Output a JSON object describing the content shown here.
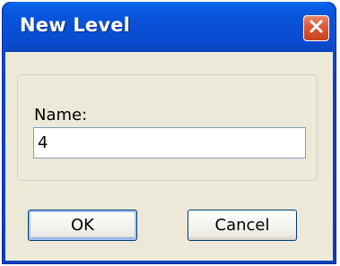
{
  "dialog": {
    "title": "New Level",
    "name_label": "Name:",
    "name_value": "4",
    "ok_label": "OK",
    "cancel_label": "Cancel"
  },
  "icons": {
    "close": "close-icon"
  },
  "colors": {
    "titlebar": "#0a4fd6",
    "close_button": "#dc5c3a",
    "client_background": "#ece9d8",
    "input_border": "#7f9db9",
    "button_border": "#003c74"
  }
}
